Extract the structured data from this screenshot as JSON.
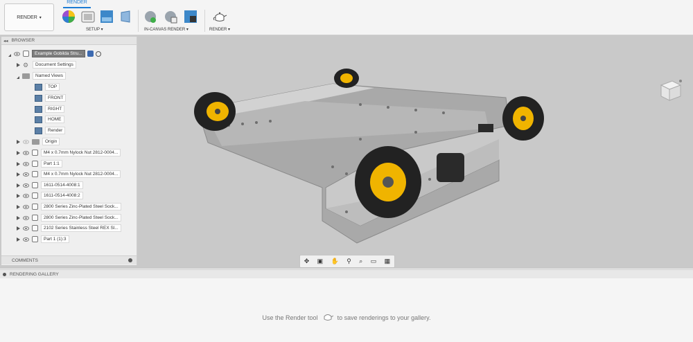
{
  "toolbar": {
    "workspace_label": "RENDER",
    "active_tab": "RENDER",
    "groups": [
      {
        "label": "SETUP ▾"
      },
      {
        "label": "IN-CANVAS RENDER ▾"
      },
      {
        "label": "RENDER ▾"
      }
    ]
  },
  "browser": {
    "title": "BROWSER",
    "root_label": "Example Gobilda Stru...",
    "items": [
      {
        "label": "Document Settings"
      },
      {
        "label": "Named Views"
      },
      {
        "label": "TOP"
      },
      {
        "label": "FRONT"
      },
      {
        "label": "RIGHT"
      },
      {
        "label": "HOME"
      },
      {
        "label": "Render"
      },
      {
        "label": "Origin"
      },
      {
        "label": "M4 x 0.7mm Nylock Nut 2812-0004..."
      },
      {
        "label": "Part 1:1"
      },
      {
        "label": "M4 x 0.7mm Nylock Nut 2812-0004..."
      },
      {
        "label": "1611-0514-4008:1"
      },
      {
        "label": "1611-0514-4008:2"
      },
      {
        "label": "2800 Series Zinc-Plated Steel Sock..."
      },
      {
        "label": "2800 Series Zinc-Plated Steel Sock..."
      },
      {
        "label": "2102 Series Stainless Steel REX Sl..."
      },
      {
        "label": "Part 1 (1):3"
      }
    ]
  },
  "comments": {
    "title": "COMMENTS"
  },
  "gallery": {
    "title": "RENDERING GALLERY",
    "message_before": "Use the Render tool",
    "message_after": "to save renderings to your gallery."
  },
  "colors": {
    "accent": "#1d7bd3",
    "canvas": "#c9c9c9",
    "wheel_yellow": "#f0b400"
  }
}
